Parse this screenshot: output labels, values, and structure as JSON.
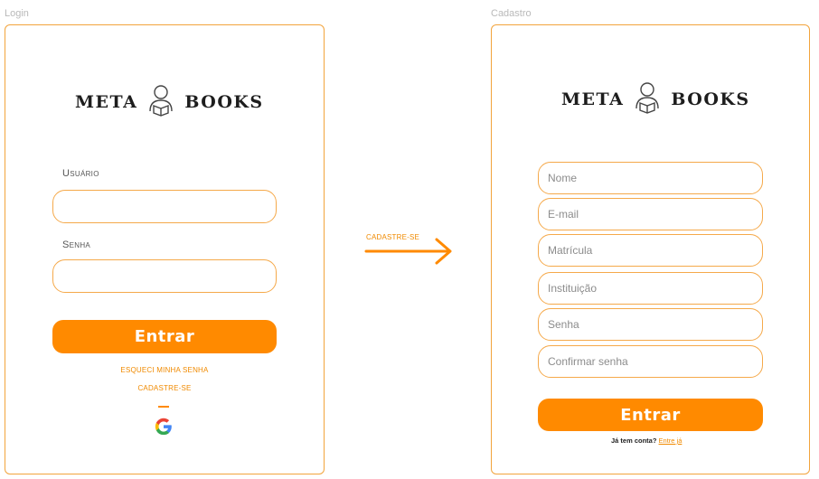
{
  "login": {
    "frame_label": "Login",
    "logo_left": "META",
    "logo_right": "BOOKS",
    "user_label": "Usuário",
    "password_label": "Senha",
    "user_value": "",
    "password_value": "",
    "submit_label": "Entrar",
    "forgot_link": "ESQUECI MINHA SENHA",
    "register_link": "CADASTRE-SE",
    "google_icon": "google-icon"
  },
  "connector": {
    "label": "CADASTRE-SE",
    "icon": "arrow-right-icon"
  },
  "register": {
    "frame_label": "Cadastro",
    "logo_left": "META",
    "logo_right": "BOOKS",
    "fields": [
      {
        "placeholder": "Nome"
      },
      {
        "placeholder": "E-mail"
      },
      {
        "placeholder": "Matrícula"
      },
      {
        "placeholder": "Instituição"
      },
      {
        "placeholder": "Senha"
      },
      {
        "placeholder": "Confirmar senha"
      }
    ],
    "submit_label": "Entrar",
    "have_account": "Já tem conta?",
    "login_link": "Entre já"
  },
  "colors": {
    "accent": "#ff8a00",
    "border": "#f5a94a"
  }
}
